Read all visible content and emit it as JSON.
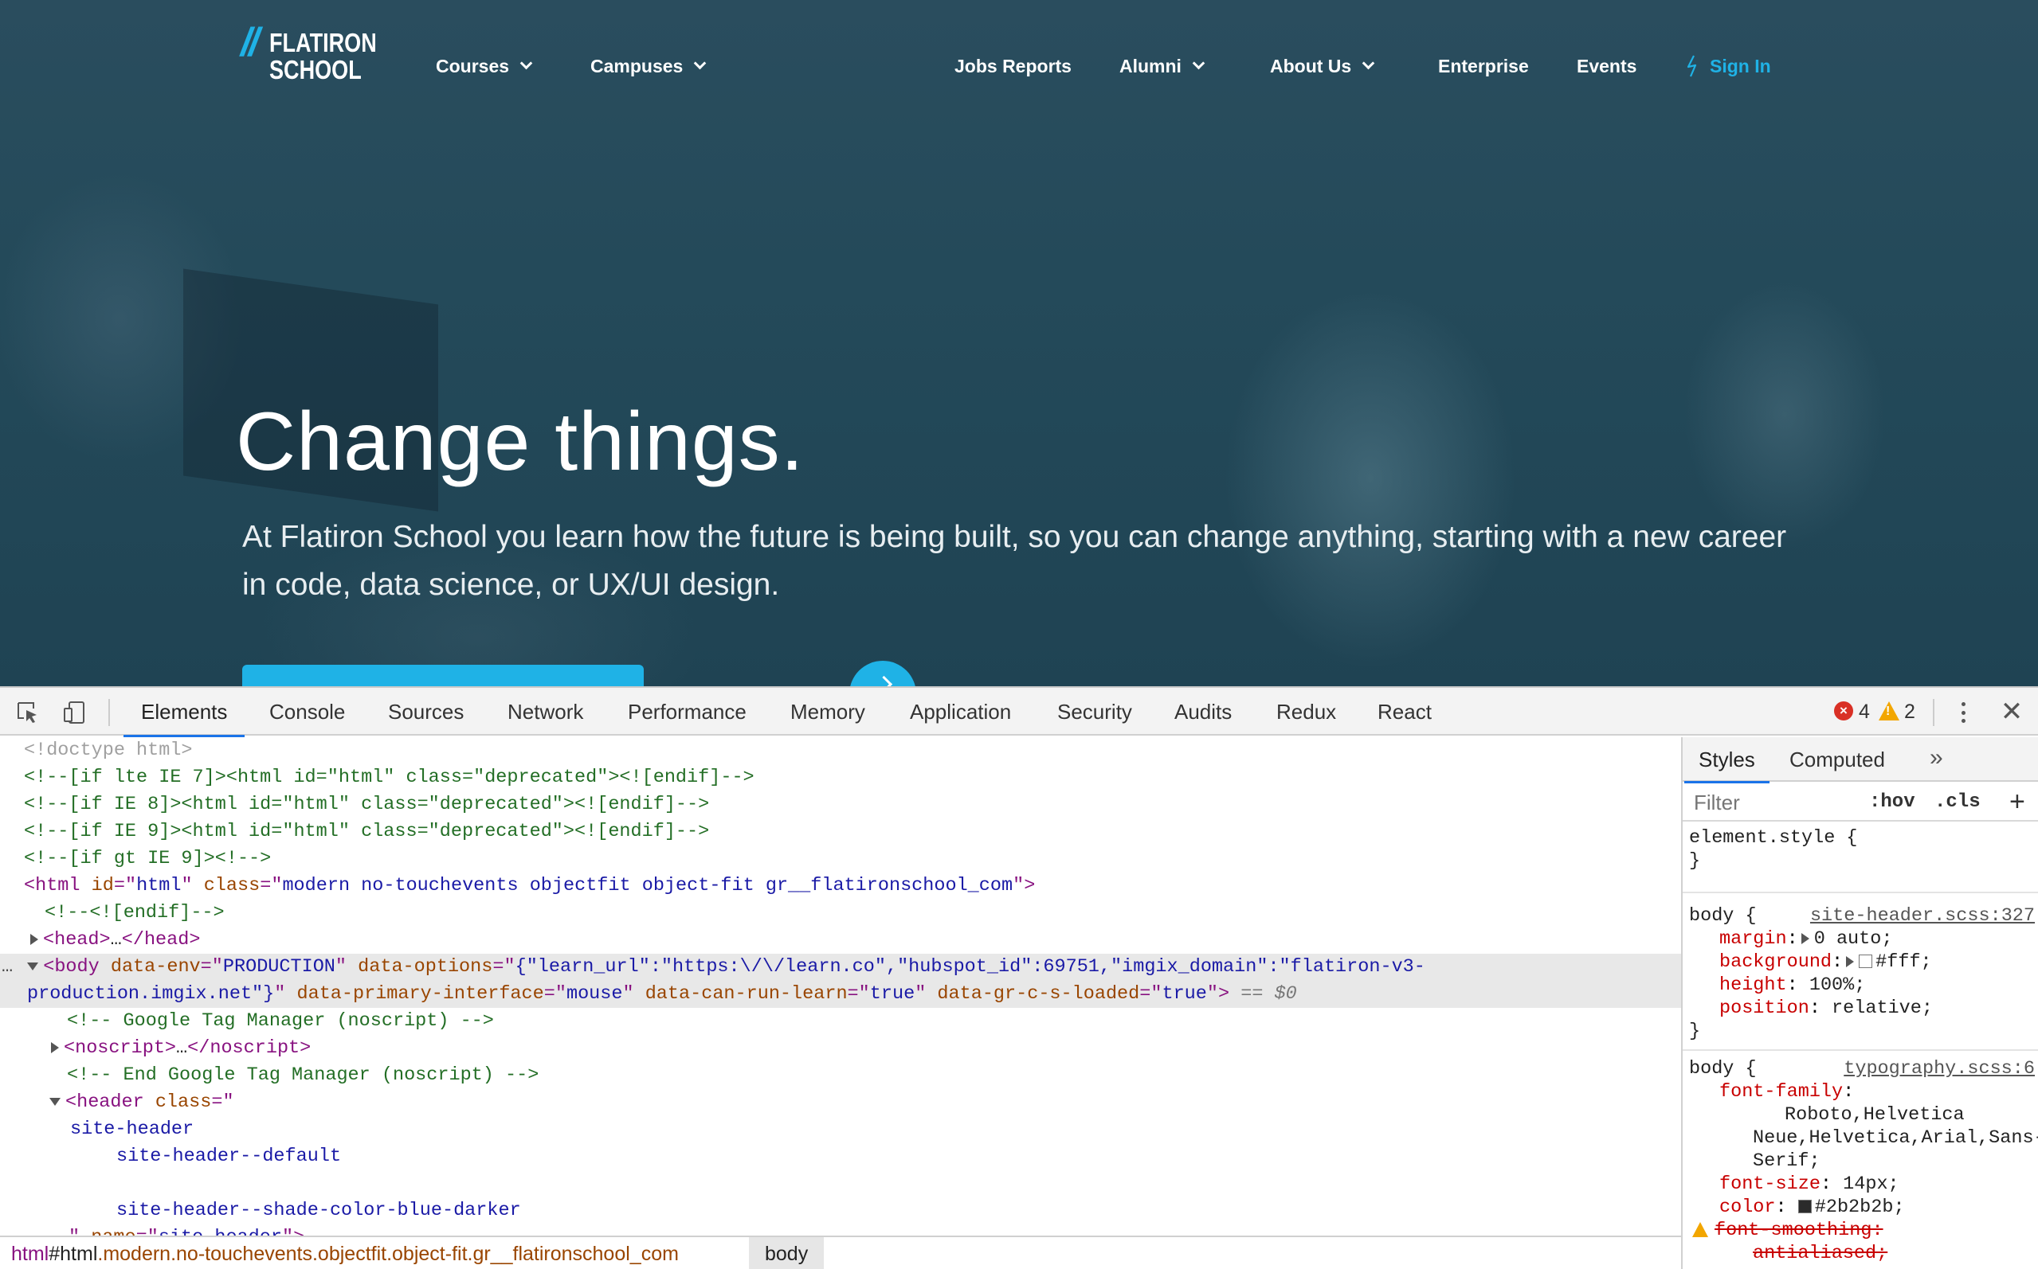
{
  "site": {
    "logo": {
      "line1": "FLATIRON",
      "line2": "SCHOOL"
    },
    "nav": {
      "courses": "Courses",
      "campuses": "Campuses",
      "jobs_reports": "Jobs Reports",
      "alumni": "Alumni",
      "about_us": "About Us",
      "enterprise": "Enterprise",
      "events": "Events",
      "sign_in": "Sign In"
    },
    "hero": {
      "title": "Change things.",
      "subtitle_line1": "At Flatiron School you learn how the future is being built, so you can change anything, starting with a new career",
      "subtitle_line2": "in code, data science, or UX/UI design."
    },
    "colors": {
      "brand_blue": "#1fb2e6",
      "hero_bg": "#244a5a"
    }
  },
  "devtools": {
    "tabs": [
      "Elements",
      "Console",
      "Sources",
      "Network",
      "Performance",
      "Memory",
      "Application",
      "Security",
      "Audits",
      "Redux",
      "React"
    ],
    "active_tab": "Elements",
    "errors": "4",
    "warnings": "2",
    "dom": {
      "l1": "<!doctype html>",
      "l2": "<!--[if lte IE 7]><html id=\"html\" class=\"deprecated\"><![endif]-->",
      "l3": "<!--[if IE 8]><html id=\"html\" class=\"deprecated\"><![endif]-->",
      "l4": "<!--[if IE 9]><html id=\"html\" class=\"deprecated\"><![endif]-->",
      "l5": "<!--[if gt IE 9]><!-->",
      "html_id": "html",
      "html_class": "modern no-touchevents objectfit object-fit gr__flatironschool_com",
      "l7": "<!--<![endif]-->",
      "head_open": "<head>",
      "head_ellipsis": "…",
      "head_close": "</head>",
      "body_env": "PRODUCTION",
      "body_options_a": "{\"learn_url\":\"https:\\/\\/learn.co\",\"hubspot_id\":69751,\"imgix_domain\":\"flatiron-v3-",
      "body_options_b": "production.imgix.net\"}",
      "body_primary_interface": "mouse",
      "body_can_run_learn": "true",
      "body_gr_loaded": "true",
      "body_suffix": "== $0",
      "gtm_open": "<!-- Google Tag Manager (noscript) -->",
      "noscript_open": "<noscript>",
      "noscript_ellipsis": "…",
      "noscript_close": "</noscript>",
      "gtm_close": "<!-- End Google Tag Manager (noscript) -->",
      "header_class_1": "site-header",
      "header_class_2": "site-header--default",
      "header_class_3": "site-header--shade-color-blue-darker",
      "header_name": "site-header"
    },
    "breadcrumb": {
      "tag": "html",
      "id": "#html",
      "classes": ".modern.no-touchevents.objectfit.object-fit.gr__flatironschool_com",
      "current": "body"
    },
    "styles": {
      "tab_styles": "Styles",
      "tab_computed": "Computed",
      "more": "»",
      "filter_placeholder": "Filter",
      "hov": ":hov",
      "cls": ".cls",
      "plus": "+",
      "element_style": "element.style {",
      "close_brace": "}",
      "rule1_selector": "body {",
      "rule1_source": "site-header.scss:327",
      "rule1_margin_prop": "margin",
      "rule1_margin_val": "0 auto;",
      "rule1_bg_prop": "background",
      "rule1_bg_val": "#fff;",
      "rule1_height_prop": "height",
      "rule1_height_val": "100%;",
      "rule1_position_prop": "position",
      "rule1_position_val": "relative;",
      "rule2_selector": "body {",
      "rule2_source": "typography.scss:6",
      "rule2_ff_prop": "font-family",
      "rule2_ff_val1": "Roboto,Helvetica",
      "rule2_ff_val2": "Neue,Helvetica,Arial,Sans-",
      "rule2_ff_val3": "Serif;",
      "rule2_fs_prop": "font-size",
      "rule2_fs_val": "14px;",
      "rule2_color_prop": "color",
      "rule2_color_val": "#2b2b2b;",
      "rule2_smooth_prop": "font-smoothing",
      "rule2_smooth_val": "antialiased;"
    }
  }
}
